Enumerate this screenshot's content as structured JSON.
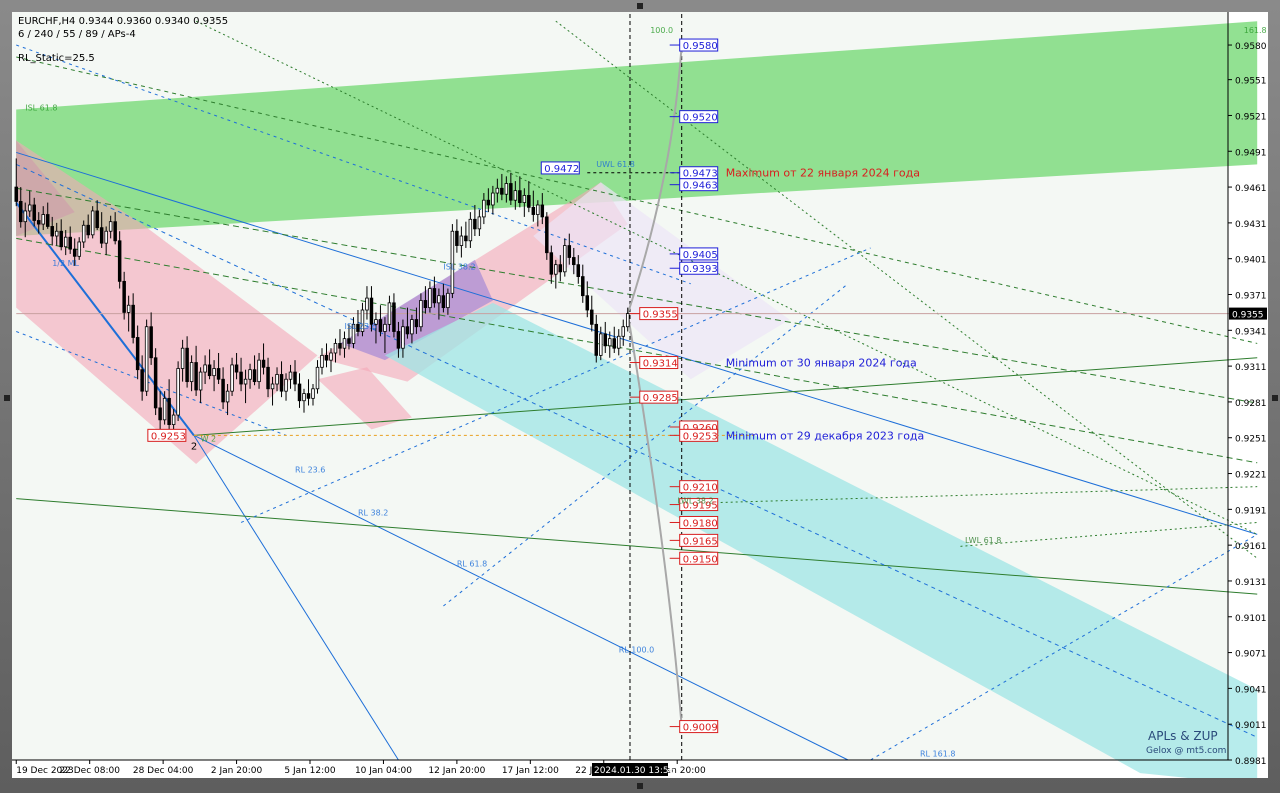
{
  "header": {
    "symbol_line": "EURCHF,H4  0.9344 0.9360 0.9340 0.9355",
    "params_line": "6 / 240 / 55 / 89 / APs-4",
    "static_line": "RL_Static=25.5"
  },
  "colors": {
    "background": "#f4f8f4",
    "bull_candle": "#ffffff",
    "bear_candle": "#000000",
    "green_zone": "#7fdc7f",
    "pink_zone": "#f4a6b8",
    "cyan_zone": "#9fe6e6",
    "purple_zone": "#a58ad6",
    "blue_line": "#1e6fd8",
    "dark_green_line": "#2e7d2e",
    "red_label": "#d81e1e",
    "blue_label": "#1e1ed8"
  },
  "watermark": {
    "line1": "APLs & ZUP",
    "line2": "Gelox @ mt5.com"
  },
  "chart_data": {
    "type": "candlestick",
    "symbol": "EURCHF",
    "timeframe": "H4",
    "ylim": [
      0.8981,
      0.9606
    ],
    "yticks": [
      0.958,
      0.9551,
      0.9521,
      0.9491,
      0.9461,
      0.9431,
      0.9401,
      0.9371,
      0.9341,
      0.9311,
      0.9281,
      0.9251,
      0.9221,
      0.9191,
      0.9161,
      0.9131,
      0.9101,
      0.9071,
      0.9041,
      0.9011,
      0.8981
    ],
    "ytick_labels": [
      "0.9580",
      "0.9551",
      "0.9521",
      "0.9491",
      "0.9461",
      "0.9431",
      "0.9401",
      "0.9371",
      "0.9341",
      "0.9311",
      "0.9281",
      "0.9251",
      "0.9221",
      "0.9191",
      "0.9161",
      "0.9131",
      "0.9101",
      "0.9071",
      "0.9041",
      "0.9011",
      "0.8981"
    ],
    "xticks": [
      "19 Dec 2023",
      "22 Dec 08:00",
      "28 Dec 04:00",
      "2 Jan 20:00",
      "5 Jan 12:00",
      "10 Jan 04:00",
      "12 Jan 20:00",
      "17 Jan 12:00",
      "22 Jan 04:00",
      "24 Jan 20:00",
      "2024.01.30 13:56"
    ],
    "current_price": "0.9355",
    "anchors": [
      {
        "label": "0.9253",
        "bar": 39.5,
        "price": 0.9253
      },
      {
        "label": "0.9472",
        "bar": 127,
        "price": 0.9472
      }
    ],
    "swing_label": "2",
    "price_levels": [
      {
        "label": "0.9580",
        "price": 0.958,
        "style": "blue"
      },
      {
        "label": "0.9520",
        "price": 0.952,
        "style": "blue"
      },
      {
        "label": "0.9473",
        "price": 0.9473,
        "style": "blue"
      },
      {
        "label": "0.9463",
        "price": 0.9463,
        "style": "blue"
      },
      {
        "label": "0.9405",
        "price": 0.9405,
        "style": "blue"
      },
      {
        "label": "0.9393",
        "price": 0.9393,
        "style": "blue"
      },
      {
        "label": "0.9355",
        "price": 0.9355,
        "style": "red"
      },
      {
        "label": "0.9314",
        "price": 0.9314,
        "style": "red"
      },
      {
        "label": "0.9285",
        "price": 0.9285,
        "style": "red"
      },
      {
        "label": "0.9260",
        "price": 0.926,
        "style": "red"
      },
      {
        "label": "0.9253",
        "price": 0.9253,
        "style": "red"
      },
      {
        "label": "0.9210",
        "price": 0.921,
        "style": "red"
      },
      {
        "label": "0.9195",
        "price": 0.9195,
        "style": "red"
      },
      {
        "label": "0.9180",
        "price": 0.918,
        "style": "red"
      },
      {
        "label": "0.9165",
        "price": 0.9165,
        "style": "red"
      },
      {
        "label": "0.9150",
        "price": 0.915,
        "style": "red"
      },
      {
        "label": "0.9009",
        "price": 0.9009,
        "style": "red"
      }
    ],
    "annotations": [
      {
        "text": "Maximum от 22 января 2024 года",
        "price": 0.9473,
        "color": "#d81e1e"
      },
      {
        "text": "Minimum от 30 января 2024 года",
        "price": 0.9314,
        "color": "#1e1ed8"
      },
      {
        "text": "Minimum от 29 декабря 2023 года",
        "price": 0.9253,
        "color": "#1e1ed8"
      }
    ],
    "line_labels": [
      {
        "text": "ISL 61.8",
        "bar": 2,
        "price": 0.9525,
        "color": "#2e9d2e"
      },
      {
        "text": "1/2 ML",
        "bar": 8,
        "price": 0.9395,
        "color": "#1e6fd8"
      },
      {
        "text": "UWL 61.8",
        "bar": 129,
        "price": 0.9478,
        "color": "#1e6fd8"
      },
      {
        "text": "ISL 38.2",
        "bar": 95,
        "price": 0.9392,
        "color": "#1e6fd8"
      },
      {
        "text": "ISL 23.6",
        "bar": 73,
        "price": 0.9342,
        "color": "#1e6fd8"
      },
      {
        "text": "RL 23.6",
        "bar": 62,
        "price": 0.9222,
        "color": "#1e6fd8"
      },
      {
        "text": "RL 38.2",
        "bar": 76,
        "price": 0.9186,
        "color": "#1e6fd8"
      },
      {
        "text": "RL 61.8",
        "bar": 98,
        "price": 0.9143,
        "color": "#1e6fd8"
      },
      {
        "text": "RL 100.0",
        "bar": 134,
        "price": 0.9071,
        "color": "#1e6fd8"
      },
      {
        "text": "RL 161.8",
        "bar": 201,
        "price": 0.8984,
        "color": "#1e6fd8"
      },
      {
        "text": "LWL 38.2",
        "bar": 147,
        "price": 0.9196,
        "color": "#2e7d2e"
      },
      {
        "text": "LWL 61.8",
        "bar": 211,
        "price": 0.9163,
        "color": "#2e7d2e"
      },
      {
        "text": "100.0",
        "bar": 141,
        "price": 0.959,
        "color": "#2e9d2e"
      },
      {
        "text": "161.8",
        "bar": 273,
        "price": 0.959,
        "color": "#2e9d2e"
      },
      {
        "text": "W 2",
        "bar": 41,
        "price": 0.9248,
        "color": "#2e9d2e"
      }
    ],
    "candles": [
      [
        0.9461,
        0.9485,
        0.9445,
        0.9449
      ],
      [
        0.9449,
        0.9461,
        0.9427,
        0.9432
      ],
      [
        0.9432,
        0.9448,
        0.9419,
        0.9441
      ],
      [
        0.9441,
        0.9458,
        0.9436,
        0.9446
      ],
      [
        0.9446,
        0.9452,
        0.9428,
        0.9433
      ],
      [
        0.9433,
        0.944,
        0.9422,
        0.943
      ],
      [
        0.943,
        0.9445,
        0.9425,
        0.9438
      ],
      [
        0.9438,
        0.9448,
        0.9426,
        0.9428
      ],
      [
        0.9428,
        0.9436,
        0.9412,
        0.942
      ],
      [
        0.942,
        0.9431,
        0.9412,
        0.9424
      ],
      [
        0.9424,
        0.9434,
        0.9408,
        0.9411
      ],
      [
        0.9411,
        0.9425,
        0.9404,
        0.9419
      ],
      [
        0.9419,
        0.9428,
        0.9405,
        0.9409
      ],
      [
        0.9409,
        0.9418,
        0.9395,
        0.9403
      ],
      [
        0.9403,
        0.9419,
        0.94,
        0.9415
      ],
      [
        0.9415,
        0.9433,
        0.941,
        0.9429
      ],
      [
        0.9429,
        0.9438,
        0.9418,
        0.9421
      ],
      [
        0.9421,
        0.9445,
        0.9418,
        0.9441
      ],
      [
        0.9441,
        0.945,
        0.9425,
        0.9427
      ],
      [
        0.9427,
        0.944,
        0.941,
        0.9414
      ],
      [
        0.9414,
        0.9428,
        0.9404,
        0.9424
      ],
      [
        0.9424,
        0.9437,
        0.9418,
        0.9432
      ],
      [
        0.9432,
        0.944,
        0.9413,
        0.9416
      ],
      [
        0.9416,
        0.9424,
        0.9376,
        0.9382
      ],
      [
        0.9382,
        0.939,
        0.935,
        0.9356
      ],
      [
        0.9356,
        0.937,
        0.934,
        0.9362
      ],
      [
        0.9362,
        0.9372,
        0.933,
        0.9335
      ],
      [
        0.9335,
        0.9345,
        0.93,
        0.9308
      ],
      [
        0.9308,
        0.932,
        0.9282,
        0.929
      ],
      [
        0.929,
        0.935,
        0.9286,
        0.9344
      ],
      [
        0.9344,
        0.9356,
        0.9312,
        0.9318
      ],
      [
        0.9318,
        0.9326,
        0.927,
        0.9276
      ],
      [
        0.9276,
        0.929,
        0.9258,
        0.9266
      ],
      [
        0.9266,
        0.929,
        0.9262,
        0.9284
      ],
      [
        0.9284,
        0.93,
        0.9255,
        0.9262
      ],
      [
        0.9262,
        0.9275,
        0.925,
        0.927
      ],
      [
        0.927,
        0.9315,
        0.9265,
        0.9309
      ],
      [
        0.9309,
        0.9333,
        0.9298,
        0.9326
      ],
      [
        0.9326,
        0.9336,
        0.9293,
        0.9298
      ],
      [
        0.9298,
        0.932,
        0.929,
        0.9314
      ],
      [
        0.9314,
        0.9328,
        0.9286,
        0.9291
      ],
      [
        0.9291,
        0.931,
        0.928,
        0.9306
      ],
      [
        0.9306,
        0.932,
        0.9296,
        0.9312
      ],
      [
        0.9312,
        0.9325,
        0.93,
        0.9303
      ],
      [
        0.9303,
        0.9316,
        0.929,
        0.9309
      ],
      [
        0.9309,
        0.9322,
        0.9296,
        0.93
      ],
      [
        0.93,
        0.931,
        0.9275,
        0.9281
      ],
      [
        0.9281,
        0.9296,
        0.927,
        0.929
      ],
      [
        0.929,
        0.9318,
        0.9286,
        0.9312
      ],
      [
        0.9312,
        0.9322,
        0.93,
        0.9306
      ],
      [
        0.9306,
        0.9318,
        0.929,
        0.9296
      ],
      [
        0.9296,
        0.9308,
        0.928,
        0.93
      ],
      [
        0.93,
        0.9313,
        0.9292,
        0.9308
      ],
      [
        0.9308,
        0.932,
        0.9295,
        0.9298
      ],
      [
        0.9298,
        0.9322,
        0.9292,
        0.9316
      ],
      [
        0.9316,
        0.933,
        0.9304,
        0.931
      ],
      [
        0.931,
        0.9318,
        0.9285,
        0.9292
      ],
      [
        0.9292,
        0.9302,
        0.9278,
        0.9296
      ],
      [
        0.9296,
        0.931,
        0.929,
        0.9304
      ],
      [
        0.9304,
        0.9315,
        0.9285,
        0.929
      ],
      [
        0.929,
        0.9305,
        0.9282,
        0.93
      ],
      [
        0.93,
        0.9312,
        0.9292,
        0.9306
      ],
      [
        0.9306,
        0.9316,
        0.929,
        0.9296
      ],
      [
        0.9296,
        0.9305,
        0.9276,
        0.9282
      ],
      [
        0.9282,
        0.9292,
        0.9272,
        0.9288
      ],
      [
        0.9288,
        0.93,
        0.9278,
        0.9284
      ],
      [
        0.9284,
        0.9296,
        0.9278,
        0.9292
      ],
      [
        0.9292,
        0.9316,
        0.9288,
        0.931
      ],
      [
        0.931,
        0.9326,
        0.9304,
        0.932
      ],
      [
        0.932,
        0.933,
        0.931,
        0.9316
      ],
      [
        0.9316,
        0.9326,
        0.9306,
        0.9322
      ],
      [
        0.9322,
        0.9334,
        0.9314,
        0.933
      ],
      [
        0.933,
        0.9342,
        0.932,
        0.9326
      ],
      [
        0.9326,
        0.934,
        0.9318,
        0.9334
      ],
      [
        0.9334,
        0.9346,
        0.9325,
        0.933
      ],
      [
        0.933,
        0.9352,
        0.9326,
        0.9346
      ],
      [
        0.9346,
        0.9358,
        0.9336,
        0.934
      ],
      [
        0.934,
        0.9364,
        0.9336,
        0.9358
      ],
      [
        0.9358,
        0.9378,
        0.935,
        0.9368
      ],
      [
        0.9368,
        0.9378,
        0.934,
        0.9346
      ],
      [
        0.9346,
        0.9356,
        0.933,
        0.935
      ],
      [
        0.935,
        0.9362,
        0.9336,
        0.934
      ],
      [
        0.934,
        0.9352,
        0.9322,
        0.9346
      ],
      [
        0.9346,
        0.937,
        0.934,
        0.9364
      ],
      [
        0.9364,
        0.9372,
        0.9335,
        0.934
      ],
      [
        0.934,
        0.9348,
        0.9318,
        0.9326
      ],
      [
        0.9326,
        0.935,
        0.9318,
        0.9344
      ],
      [
        0.9344,
        0.936,
        0.9334,
        0.9338
      ],
      [
        0.9338,
        0.9354,
        0.933,
        0.935
      ],
      [
        0.935,
        0.936,
        0.9338,
        0.9344
      ],
      [
        0.9344,
        0.9372,
        0.934,
        0.9366
      ],
      [
        0.9366,
        0.9378,
        0.9355,
        0.936
      ],
      [
        0.936,
        0.9382,
        0.9356,
        0.9376
      ],
      [
        0.9376,
        0.9386,
        0.936,
        0.9364
      ],
      [
        0.9364,
        0.9376,
        0.935,
        0.937
      ],
      [
        0.937,
        0.938,
        0.9356,
        0.936
      ],
      [
        0.936,
        0.9376,
        0.9354,
        0.9372
      ],
      [
        0.9372,
        0.943,
        0.9368,
        0.9424
      ],
      [
        0.9424,
        0.9434,
        0.9406,
        0.9412
      ],
      [
        0.9412,
        0.9428,
        0.9402,
        0.942
      ],
      [
        0.942,
        0.9432,
        0.941,
        0.9416
      ],
      [
        0.9416,
        0.944,
        0.941,
        0.9434
      ],
      [
        0.9434,
        0.9446,
        0.942,
        0.9426
      ],
      [
        0.9426,
        0.9442,
        0.942,
        0.9436
      ],
      [
        0.9436,
        0.9456,
        0.943,
        0.945
      ],
      [
        0.945,
        0.946,
        0.944,
        0.9446
      ],
      [
        0.9446,
        0.9462,
        0.9438,
        0.9456
      ],
      [
        0.9456,
        0.9468,
        0.9448,
        0.946
      ],
      [
        0.946,
        0.9472,
        0.945,
        0.9455
      ],
      [
        0.9455,
        0.947,
        0.9448,
        0.9464
      ],
      [
        0.9464,
        0.9473,
        0.9446,
        0.945
      ],
      [
        0.945,
        0.9466,
        0.9442,
        0.9458
      ],
      [
        0.9458,
        0.947,
        0.9444,
        0.9448
      ],
      [
        0.9448,
        0.946,
        0.9436,
        0.9454
      ],
      [
        0.9454,
        0.9466,
        0.944,
        0.9444
      ],
      [
        0.9444,
        0.9458,
        0.9432,
        0.9438
      ],
      [
        0.9438,
        0.945,
        0.9428,
        0.9446
      ],
      [
        0.9446,
        0.9456,
        0.943,
        0.9436
      ],
      [
        0.9436,
        0.944,
        0.94,
        0.9406
      ],
      [
        0.9406,
        0.9412,
        0.938,
        0.9388
      ],
      [
        0.9388,
        0.94,
        0.9376,
        0.9396
      ],
      [
        0.9396,
        0.9404,
        0.9382,
        0.939
      ],
      [
        0.939,
        0.9418,
        0.9386,
        0.9412
      ],
      [
        0.9412,
        0.9422,
        0.9396,
        0.9402
      ],
      [
        0.9402,
        0.941,
        0.9388,
        0.9396
      ],
      [
        0.9396,
        0.9404,
        0.938,
        0.9386
      ],
      [
        0.9386,
        0.9396,
        0.9364,
        0.937
      ],
      [
        0.937,
        0.9382,
        0.9352,
        0.9358
      ],
      [
        0.9358,
        0.937,
        0.934,
        0.9346
      ],
      [
        0.9346,
        0.9354,
        0.9314,
        0.932
      ],
      [
        0.932,
        0.9344,
        0.9316,
        0.9338
      ],
      [
        0.9338,
        0.9348,
        0.9322,
        0.9328
      ],
      [
        0.9328,
        0.934,
        0.9318,
        0.9334
      ],
      [
        0.9334,
        0.9344,
        0.9322,
        0.9326
      ],
      [
        0.9326,
        0.9342,
        0.932,
        0.9336
      ],
      [
        0.9336,
        0.935,
        0.9328,
        0.9344
      ],
      [
        0.9344,
        0.936,
        0.934,
        0.9355
      ]
    ]
  }
}
